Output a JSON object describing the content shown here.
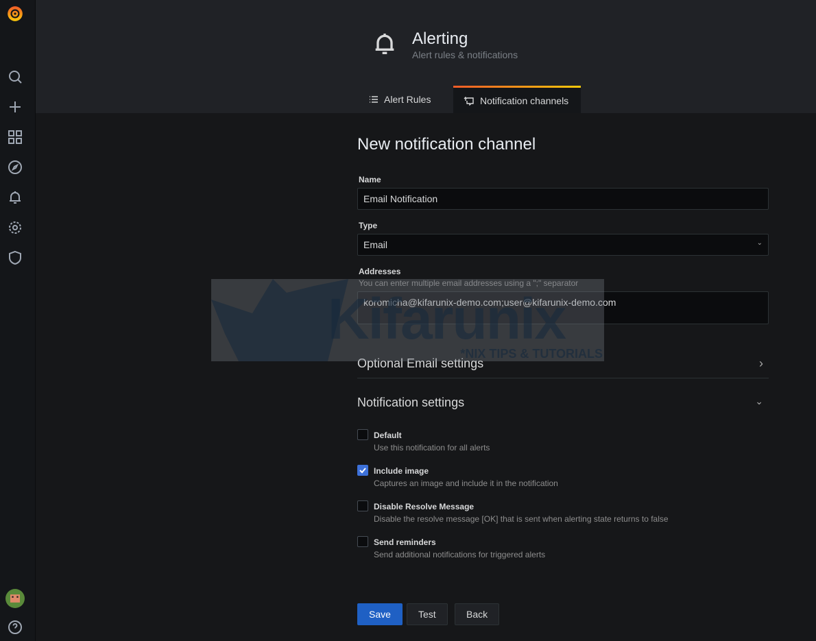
{
  "sidebar": {
    "items": [
      "grafana-logo",
      "search",
      "create",
      "dashboards",
      "explore",
      "alerting",
      "configuration",
      "server-admin"
    ],
    "bottom": [
      "user-avatar",
      "help"
    ]
  },
  "header": {
    "title": "Alerting",
    "subtitle": "Alert rules & notifications",
    "tabs": [
      {
        "label": "Alert Rules",
        "icon": "list-icon",
        "active": false
      },
      {
        "label": "Notification channels",
        "icon": "comment-alt-share-icon",
        "active": true
      }
    ]
  },
  "form": {
    "heading": "New notification channel",
    "name_label": "Name",
    "name_value": "Email Notification",
    "type_label": "Type",
    "type_value": "Email",
    "addresses_label": "Addresses",
    "addresses_desc": "You can enter multiple email addresses using a \";\" separator",
    "addresses_value": "koromicha@kifarunix-demo.com;user@kifarunix-demo.com",
    "optional_section": "Optional Email settings",
    "notification_section": "Notification settings",
    "options": [
      {
        "label": "Default",
        "desc": "Use this notification for all alerts",
        "checked": false
      },
      {
        "label": "Include image",
        "desc": "Captures an image and include it in the notification",
        "checked": true
      },
      {
        "label": "Disable Resolve Message",
        "desc": "Disable the resolve message [OK] that is sent when alerting state returns to false",
        "checked": false
      },
      {
        "label": "Send reminders",
        "desc": "Send additional notifications for triggered alerts",
        "checked": false
      }
    ],
    "save": "Save",
    "test": "Test",
    "back": "Back"
  },
  "watermark": {
    "text": "Kifarunix",
    "tagline": "*NIX TIPS & TUTORIALS"
  },
  "colors": {
    "primary": "#1f60c4",
    "checkbox": "#3d71d9",
    "tab_accent_start": "#f05a28",
    "tab_accent_end": "#fbca0a"
  }
}
